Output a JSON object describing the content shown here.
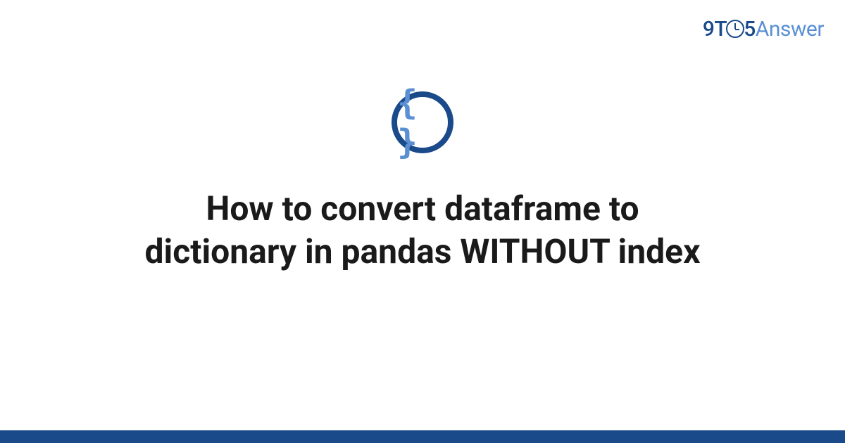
{
  "logo": {
    "part1": "9T",
    "part2": "5",
    "part3": "Answer"
  },
  "icon": {
    "braces": "{ }"
  },
  "title": "How to convert dataframe to dictionary in pandas WITHOUT index"
}
